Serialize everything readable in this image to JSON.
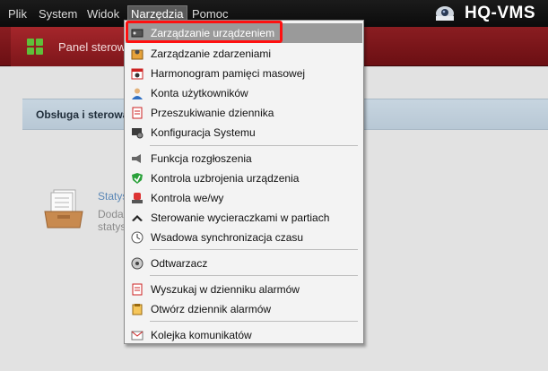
{
  "menubar": {
    "items": [
      "Plik",
      "System",
      "Widok",
      "Narzędzia",
      "Pomoc"
    ],
    "active_index": 3
  },
  "brand": {
    "title": "HQ-VMS"
  },
  "tabbar": {
    "panel_tab_label": "Panel sterowa"
  },
  "main": {
    "section_title": "Obsługa i sterowa",
    "stat_card": {
      "title": "Statys",
      "description_lines": [
        "Dodav",
        "statys"
      ]
    }
  },
  "dropdown": {
    "items": [
      {
        "label": "Zarządzanie urządzeniem",
        "icon": "device-manage-icon",
        "highlighted": true
      },
      {
        "label": "Zarządzanie zdarzeniami",
        "icon": "event-manage-icon"
      },
      {
        "label": "Harmonogram pamięci masowej",
        "icon": "storage-schedule-icon"
      },
      {
        "label": "Konta użytkowników",
        "icon": "user-accounts-icon"
      },
      {
        "label": "Przeszukiwanie dziennika",
        "icon": "log-search-icon"
      },
      {
        "label": "Konfiguracja Systemu",
        "icon": "system-config-icon"
      },
      {
        "label": "Funkcja rozgłoszenia",
        "icon": "broadcast-icon"
      },
      {
        "label": "Kontrola uzbrojenia urządzenia",
        "icon": "arming-control-icon"
      },
      {
        "label": "Kontrola we/wy",
        "icon": "io-control-icon"
      },
      {
        "label": "Sterowanie wycieraczkami w partiach",
        "icon": "wiper-control-icon"
      },
      {
        "label": "Wsadowa synchronizacja czasu",
        "icon": "time-sync-icon"
      },
      {
        "label": "Odtwarzacz",
        "icon": "player-icon"
      },
      {
        "label": "Wyszukaj w dzienniku alarmów",
        "icon": "alarm-log-search-icon"
      },
      {
        "label": "Otwórz dziennik alarmów",
        "icon": "alarm-log-open-icon"
      },
      {
        "label": "Kolejka komunikatów",
        "icon": "message-queue-icon"
      }
    ]
  },
  "colors": {
    "menubar_bg": "#111111",
    "tabbar_red": "#7d161a",
    "highlight": "#ff1010",
    "section_head": "#bfcedb"
  }
}
